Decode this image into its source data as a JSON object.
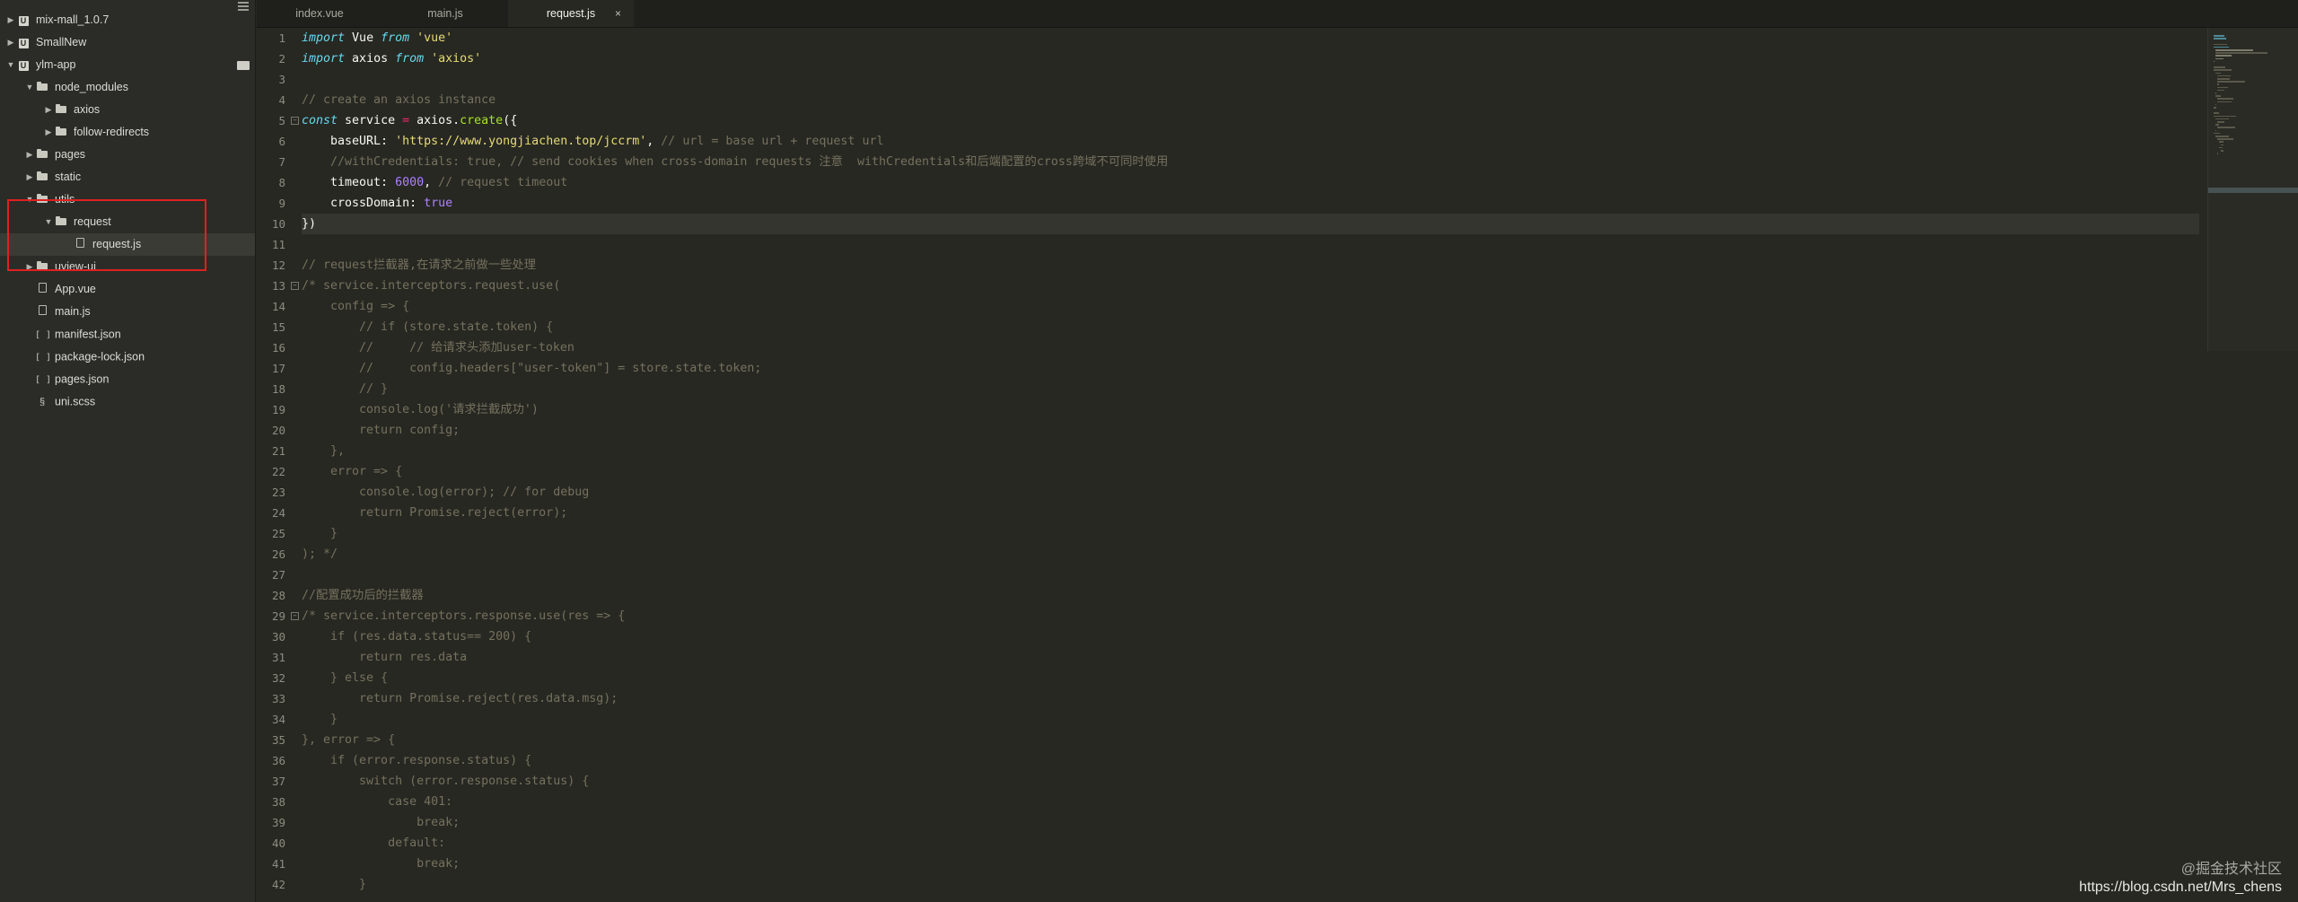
{
  "sidebar": {
    "items": [
      {
        "label": "mix-mall_1.0.7",
        "kind": "project",
        "depth": 0,
        "expanded": false
      },
      {
        "label": "SmallNew",
        "kind": "project",
        "depth": 0,
        "expanded": false
      },
      {
        "label": "ylm-app",
        "kind": "project",
        "depth": 0,
        "expanded": true
      },
      {
        "label": "node_modules",
        "kind": "folder",
        "depth": 1,
        "expanded": true
      },
      {
        "label": "axios",
        "kind": "folder",
        "depth": 2,
        "expanded": false
      },
      {
        "label": "follow-redirects",
        "kind": "folder",
        "depth": 2,
        "expanded": false
      },
      {
        "label": "pages",
        "kind": "folder",
        "depth": 1,
        "expanded": false
      },
      {
        "label": "static",
        "kind": "folder",
        "depth": 1,
        "expanded": false
      },
      {
        "label": "utils",
        "kind": "folder",
        "depth": 1,
        "expanded": true
      },
      {
        "label": "request",
        "kind": "folder",
        "depth": 2,
        "expanded": true
      },
      {
        "label": "request.js",
        "kind": "file",
        "depth": 3,
        "selected": true
      },
      {
        "label": "uview-ui",
        "kind": "folder",
        "depth": 1,
        "expanded": false
      },
      {
        "label": "App.vue",
        "kind": "file",
        "depth": 1
      },
      {
        "label": "main.js",
        "kind": "file",
        "depth": 1
      },
      {
        "label": "manifest.json",
        "kind": "json",
        "depth": 1
      },
      {
        "label": "package-lock.json",
        "kind": "json",
        "depth": 1
      },
      {
        "label": "pages.json",
        "kind": "json",
        "depth": 1
      },
      {
        "label": "uni.scss",
        "kind": "scss",
        "depth": 1
      }
    ]
  },
  "tabs": [
    {
      "label": "index.vue",
      "active": false
    },
    {
      "label": "main.js",
      "active": false
    },
    {
      "label": "request.js",
      "active": true,
      "close": "×"
    }
  ],
  "editor": {
    "lines": [
      {
        "n": "1",
        "code": [
          [
            "kw",
            "import"
          ],
          [
            "id",
            " Vue "
          ],
          [
            "kw",
            "from"
          ],
          [
            "str",
            " 'vue'"
          ]
        ]
      },
      {
        "n": "2",
        "code": [
          [
            "kw",
            "import"
          ],
          [
            "id",
            " axios "
          ],
          [
            "kw",
            "from"
          ],
          [
            "str",
            " 'axios'"
          ]
        ]
      },
      {
        "n": "3",
        "code": []
      },
      {
        "n": "4",
        "code": [
          [
            "cm",
            "// create an axios instance"
          ]
        ]
      },
      {
        "n": "5",
        "fold": true,
        "code": [
          [
            "kw",
            "const"
          ],
          [
            "id",
            " service "
          ],
          [
            "kw2",
            "="
          ],
          [
            "id",
            " axios."
          ],
          [
            "fn",
            "create"
          ],
          [
            "id",
            "({"
          ]
        ]
      },
      {
        "n": "6",
        "code": [
          [
            "id",
            "    baseURL: "
          ],
          [
            "str",
            "'https://www.yongjiachen.top/jccrm'"
          ],
          [
            "id",
            ", "
          ],
          [
            "cm",
            "// url = base url + request url"
          ]
        ]
      },
      {
        "n": "7",
        "code": [
          [
            "cm",
            "    //withCredentials: true, // send cookies when cross-domain requests 注意  withCredentials和后端配置的cross跨域不可同时使用"
          ]
        ]
      },
      {
        "n": "8",
        "code": [
          [
            "id",
            "    timeout: "
          ],
          [
            "num",
            "6000"
          ],
          [
            "id",
            ", "
          ],
          [
            "cm",
            "// request timeout"
          ]
        ]
      },
      {
        "n": "9",
        "code": [
          [
            "id",
            "    crossDomain: "
          ],
          [
            "num",
            "true"
          ]
        ]
      },
      {
        "n": "10",
        "hl": true,
        "code": [
          [
            "id",
            "})"
          ]
        ]
      },
      {
        "n": "11",
        "code": []
      },
      {
        "n": "12",
        "code": [
          [
            "cm",
            "// request拦截器,在请求之前做一些处理"
          ]
        ]
      },
      {
        "n": "13",
        "fold": true,
        "code": [
          [
            "cm",
            "/* service.interceptors.request.use("
          ]
        ]
      },
      {
        "n": "14",
        "code": [
          [
            "cm",
            "    config => {"
          ]
        ]
      },
      {
        "n": "15",
        "code": [
          [
            "cm",
            "        // if (store.state.token) {"
          ]
        ]
      },
      {
        "n": "16",
        "code": [
          [
            "cm",
            "        //     // 给请求头添加user-token"
          ]
        ]
      },
      {
        "n": "17",
        "code": [
          [
            "cm",
            "        //     config.headers[\"user-token\"] = store.state.token;"
          ]
        ]
      },
      {
        "n": "18",
        "code": [
          [
            "cm",
            "        // }"
          ]
        ]
      },
      {
        "n": "19",
        "code": [
          [
            "cm",
            "        console.log('请求拦截成功')"
          ]
        ]
      },
      {
        "n": "20",
        "code": [
          [
            "cm",
            "        return config;"
          ]
        ]
      },
      {
        "n": "21",
        "code": [
          [
            "cm",
            "    },"
          ]
        ]
      },
      {
        "n": "22",
        "code": [
          [
            "cm",
            "    error => {"
          ]
        ]
      },
      {
        "n": "23",
        "code": [
          [
            "cm",
            "        console.log(error); // for debug"
          ]
        ]
      },
      {
        "n": "24",
        "code": [
          [
            "cm",
            "        return Promise.reject(error);"
          ]
        ]
      },
      {
        "n": "25",
        "code": [
          [
            "cm",
            "    }"
          ]
        ]
      },
      {
        "n": "26",
        "code": [
          [
            "cm",
            "); */"
          ]
        ]
      },
      {
        "n": "27",
        "code": []
      },
      {
        "n": "28",
        "code": [
          [
            "cm",
            "//配置成功后的拦截器"
          ]
        ]
      },
      {
        "n": "29",
        "fold": true,
        "code": [
          [
            "cm",
            "/* service.interceptors.response.use(res => {"
          ]
        ]
      },
      {
        "n": "30",
        "code": [
          [
            "cm",
            "    if (res.data.status== 200) {"
          ]
        ]
      },
      {
        "n": "31",
        "code": [
          [
            "cm",
            "        return res.data"
          ]
        ]
      },
      {
        "n": "32",
        "code": [
          [
            "cm",
            "    } else {"
          ]
        ]
      },
      {
        "n": "33",
        "code": [
          [
            "cm",
            "        return Promise.reject(res.data.msg);"
          ]
        ]
      },
      {
        "n": "34",
        "code": [
          [
            "cm",
            "    }"
          ]
        ]
      },
      {
        "n": "35",
        "code": [
          [
            "cm",
            "}, error => {"
          ]
        ]
      },
      {
        "n": "36",
        "code": [
          [
            "cm",
            "    if (error.response.status) {"
          ]
        ]
      },
      {
        "n": "37",
        "code": [
          [
            "cm",
            "        switch (error.response.status) {"
          ]
        ]
      },
      {
        "n": "38",
        "code": [
          [
            "cm",
            "            case 401:"
          ]
        ]
      },
      {
        "n": "39",
        "code": [
          [
            "cm",
            "                break;"
          ]
        ]
      },
      {
        "n": "40",
        "code": [
          [
            "cm",
            "            default:"
          ]
        ]
      },
      {
        "n": "41",
        "code": [
          [
            "cm",
            "                break;"
          ]
        ]
      },
      {
        "n": "42",
        "code": [
          [
            "cm",
            "        }"
          ]
        ]
      }
    ]
  },
  "watermark": {
    "line1": "@掘金技术社区",
    "line2": "https://blog.csdn.net/Mrs_chens"
  },
  "colors": {
    "background": "#272822",
    "sidebar": "#2b2c27",
    "annotation": "#e02020",
    "keyword": "#66d9ef",
    "string": "#e6db74",
    "comment": "#75715e",
    "number": "#ae81ff",
    "function": "#a6e22e"
  }
}
